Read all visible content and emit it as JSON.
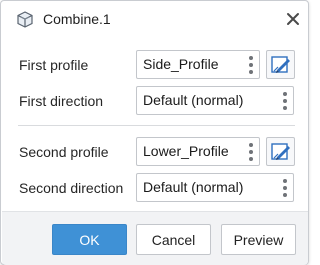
{
  "window": {
    "title": "Combine.1"
  },
  "fields": {
    "first_profile": {
      "label": "First profile",
      "value": "Side_Profile"
    },
    "first_direction": {
      "label": "First direction",
      "value": "Default (normal)"
    },
    "second_profile": {
      "label": "Second profile",
      "value": "Lower_Profile"
    },
    "second_direction": {
      "label": "Second direction",
      "value": "Default (normal)"
    }
  },
  "buttons": {
    "ok": "OK",
    "cancel": "Cancel",
    "preview": "Preview"
  },
  "colors": {
    "accent": "#3f91d6",
    "footer_bg": "#f2f3f5",
    "edit_icon_blue": "#2f6fbf"
  },
  "icons": {
    "title": "combine-feature-icon",
    "close": "close-icon",
    "menu": "kebab-menu-icon",
    "edit": "sketch-edit-icon"
  }
}
